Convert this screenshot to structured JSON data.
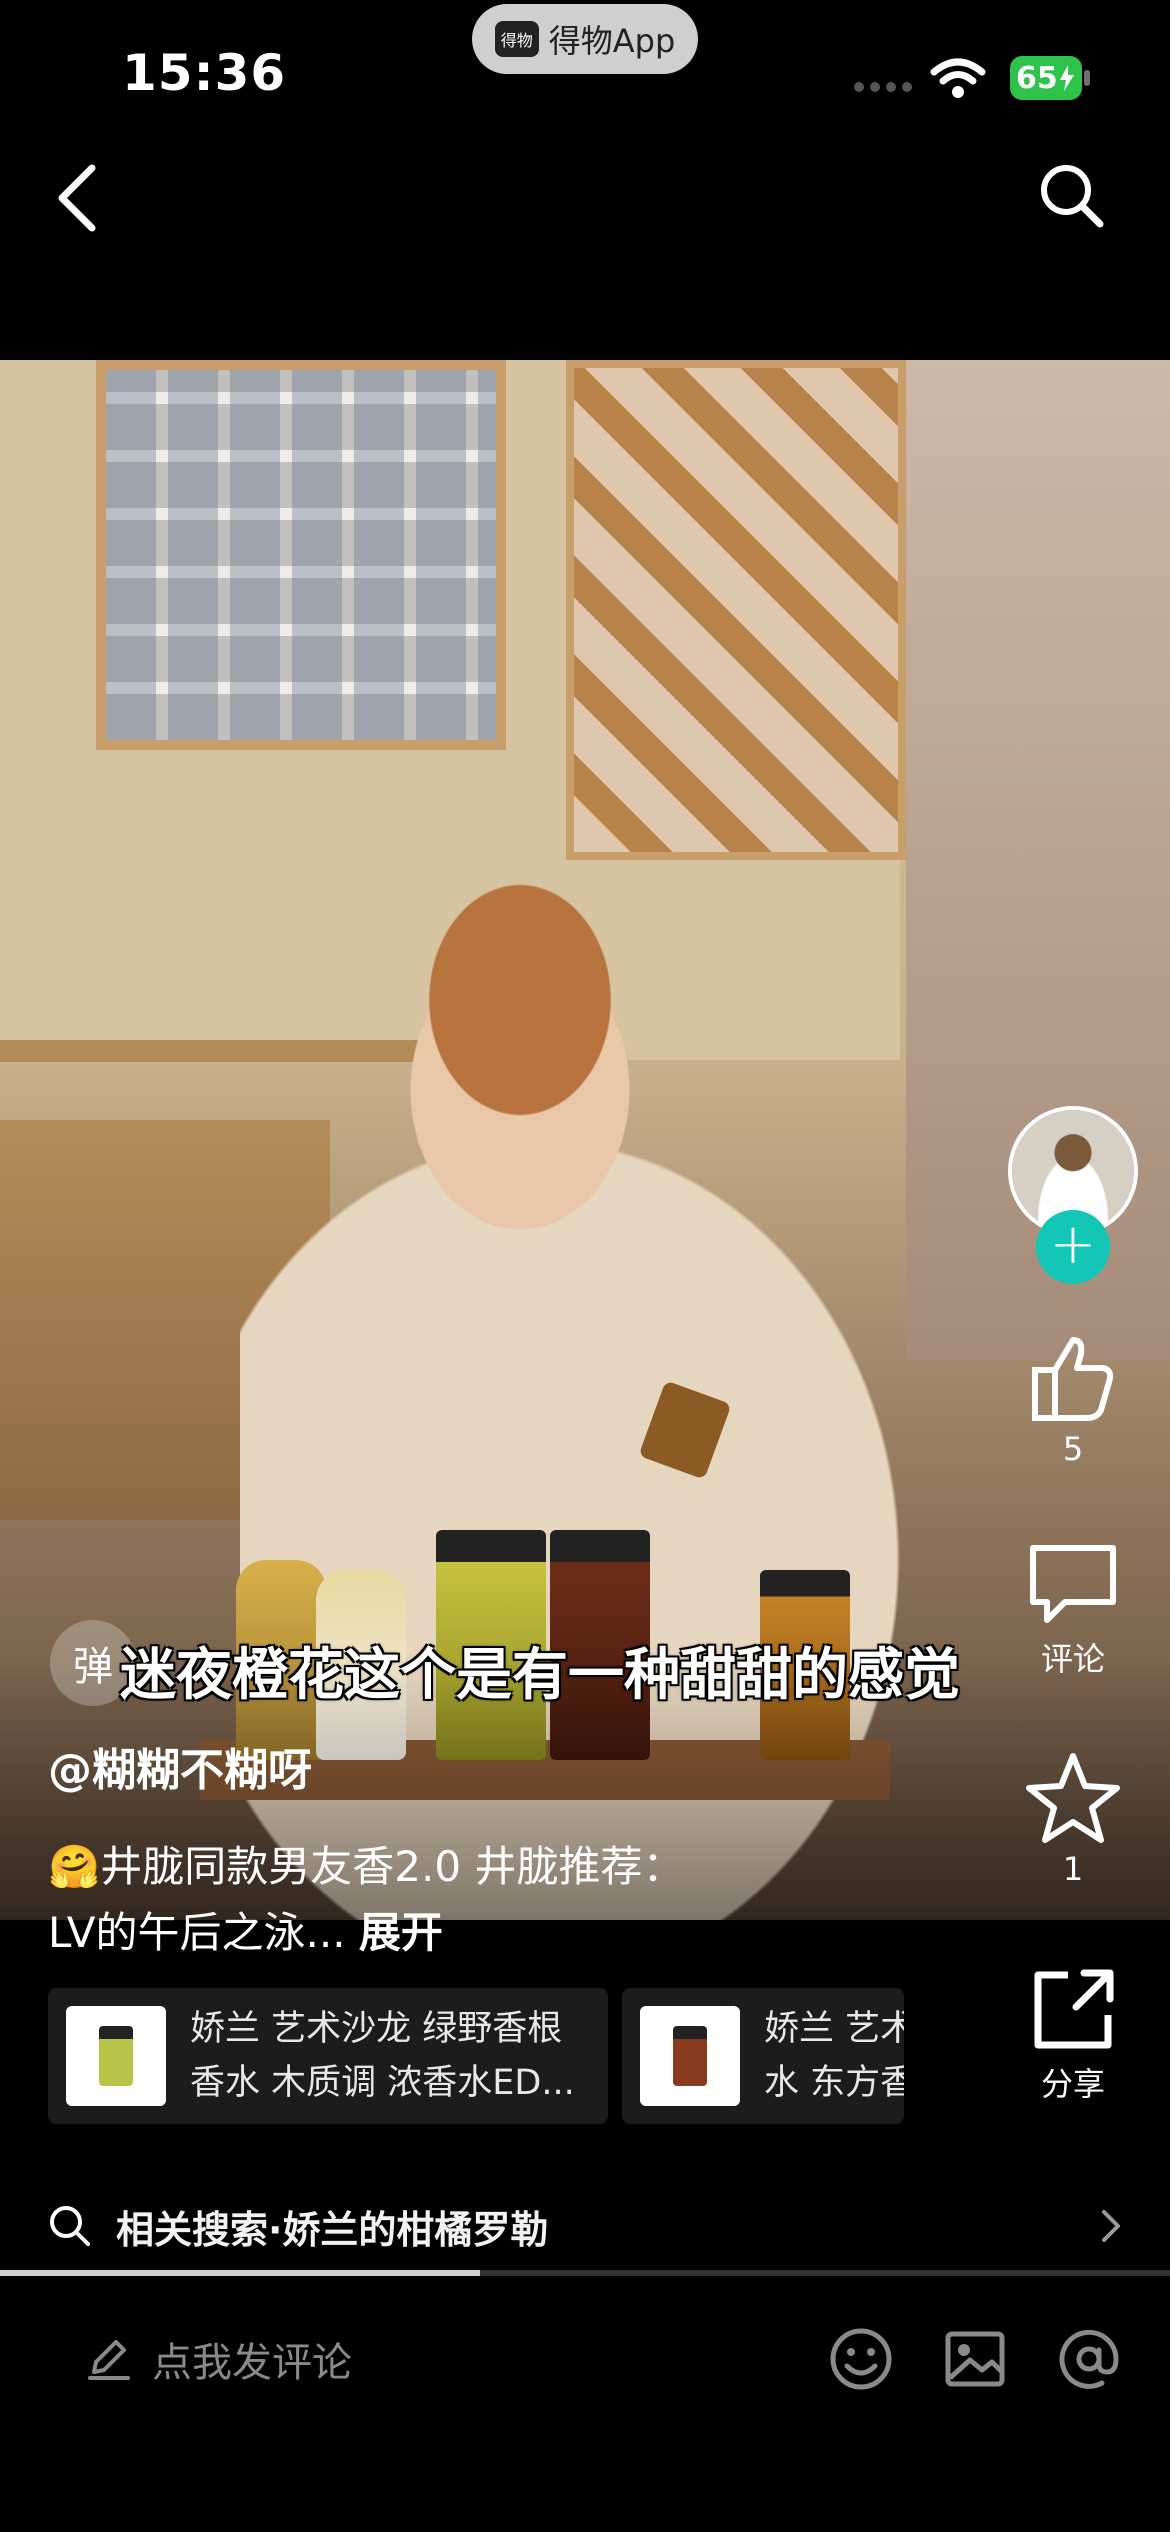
{
  "status_bar": {
    "time": "15:36",
    "app_pill": "得物App",
    "app_logo": "得物",
    "battery": "65"
  },
  "nav": {
    "back_icon": "chevron-left-icon",
    "search_icon": "search-icon"
  },
  "video": {
    "subtitle": "迷夜橙花这个是有一种甜甜的感觉",
    "danmaku_toggle": "弹"
  },
  "actions": {
    "follow": "+",
    "like_count": "5",
    "comment_label": "评论",
    "favorite_count": "1",
    "share_label": "分享"
  },
  "post": {
    "author": "@糊糊不糊呀",
    "caption_line1": "🤗井胧同款男友香2.0 井胧推荐：",
    "caption_line2": "LV的午后之泳... ",
    "expand": "展开"
  },
  "products": [
    {
      "name_line1": "娇兰 艺术沙龙 绿野香根",
      "name_line2": "香水 木质调 浓香水ED...",
      "swatch": "#b8c44a"
    },
    {
      "name_line1": "娇兰 艺术",
      "name_line2": "水 东方香",
      "swatch": "#8a3a1e"
    }
  ],
  "related_search": {
    "text": "相关搜索·娇兰的柑橘罗勒"
  },
  "progress": {
    "fraction": 0.41
  },
  "bottom_bar": {
    "comment_placeholder": "点我发评论"
  },
  "colors": {
    "follow_accent": "#13c6b6",
    "battery": "#2fc24a"
  }
}
